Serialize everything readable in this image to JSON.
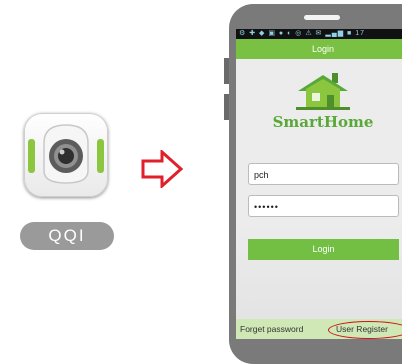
{
  "app": {
    "label": "QQI",
    "icon": "camera-app-icon"
  },
  "arrow": {
    "icon": "right-arrow-icon",
    "color": "#e0202a"
  },
  "phone": {
    "status_bar": "⚙ ✚ ◆ ▣ ● ◐ ◎ ⚠ ✉ ▂▄▆ ■ 17",
    "title": "Login",
    "brand": "SmartHome",
    "username": "pch",
    "password_mask": "••••••",
    "login_button": "Login",
    "forget_password": "Forget password",
    "user_register": "User Register"
  },
  "colors": {
    "accent": "#7ac143",
    "highlight": "#d0141b"
  }
}
